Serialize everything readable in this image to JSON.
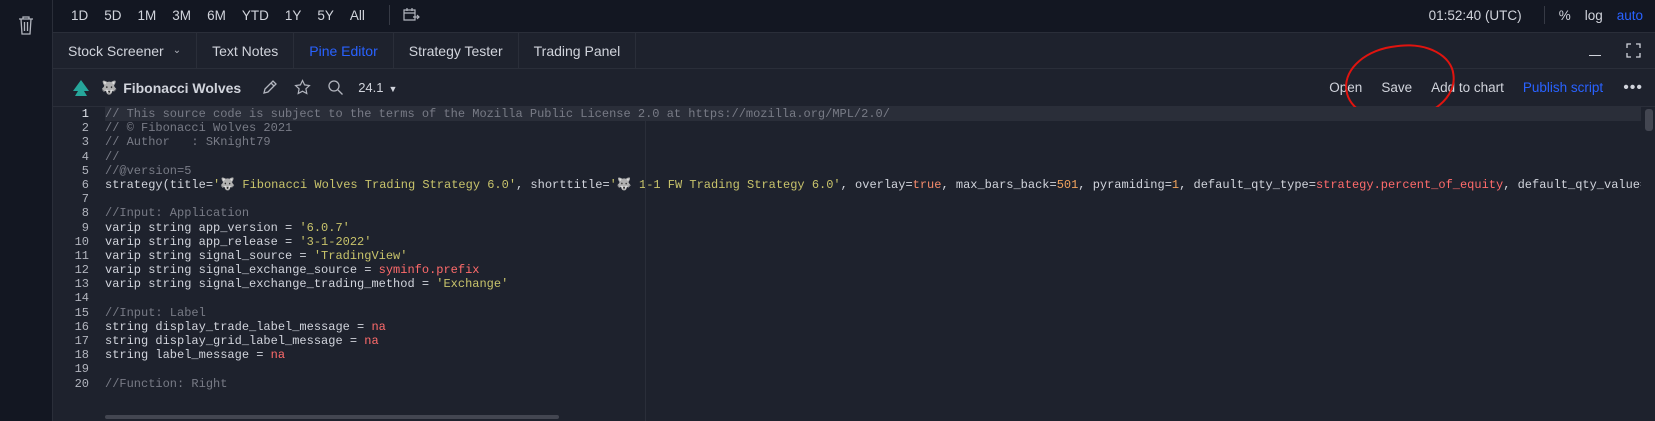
{
  "topbar": {
    "ranges": [
      "1D",
      "5D",
      "1M",
      "3M",
      "6M",
      "YTD",
      "1Y",
      "5Y",
      "All"
    ],
    "clock": "01:52:40 (UTC)",
    "options": {
      "percent": "%",
      "log": "log",
      "auto": "auto"
    }
  },
  "tabs": [
    {
      "label": "Stock Screener",
      "has_dropdown": true,
      "active": false
    },
    {
      "label": "Text Notes",
      "active": false
    },
    {
      "label": "Pine Editor",
      "active": true
    },
    {
      "label": "Strategy Tester",
      "active": false
    },
    {
      "label": "Trading Panel",
      "active": false
    }
  ],
  "toolbar": {
    "script_icon": "🐺",
    "script_name": "Fibonacci Wolves",
    "version": "24.1",
    "open_label": "Open",
    "save_label": "Save",
    "add_to_chart_label": "Add to chart",
    "publish_label": "Publish script",
    "more_label": "•••"
  },
  "colors": {
    "accent": "#2962ff",
    "background": "#131722",
    "panel": "#1e222d",
    "annotation_circle": "#e0140f"
  },
  "editor": {
    "current_line": 1,
    "lines": [
      "// This source code is subject to the terms of the Mozilla Public License 2.0 at https://mozilla.org/MPL/2.0/",
      "// © Fibonacci Wolves 2021",
      "// Author   : SKnight79",
      "//",
      "//@version=5",
      "strategy(title='🐺 Fibonacci Wolves Trading Strategy 6.0', shorttitle='🐺 1-1 FW Trading Strategy 6.0', overlay=true, max_bars_back=501, pyramiding=1, default_qty_type=strategy.percent_of_equity, default_qty_value=",
      "",
      "//Input: Application",
      "varip string app_version = '6.0.7'",
      "varip string app_release = '3-1-2022'",
      "varip string signal_source = 'TradingView'",
      "varip string signal_exchange_source = syminfo.prefix",
      "varip string signal_exchange_trading_method = 'Exchange'",
      "",
      "//Input: Label",
      "string display_trade_label_message = na",
      "string display_grid_label_message = na",
      "string label_message = na",
      "",
      "//Function: Right"
    ]
  }
}
